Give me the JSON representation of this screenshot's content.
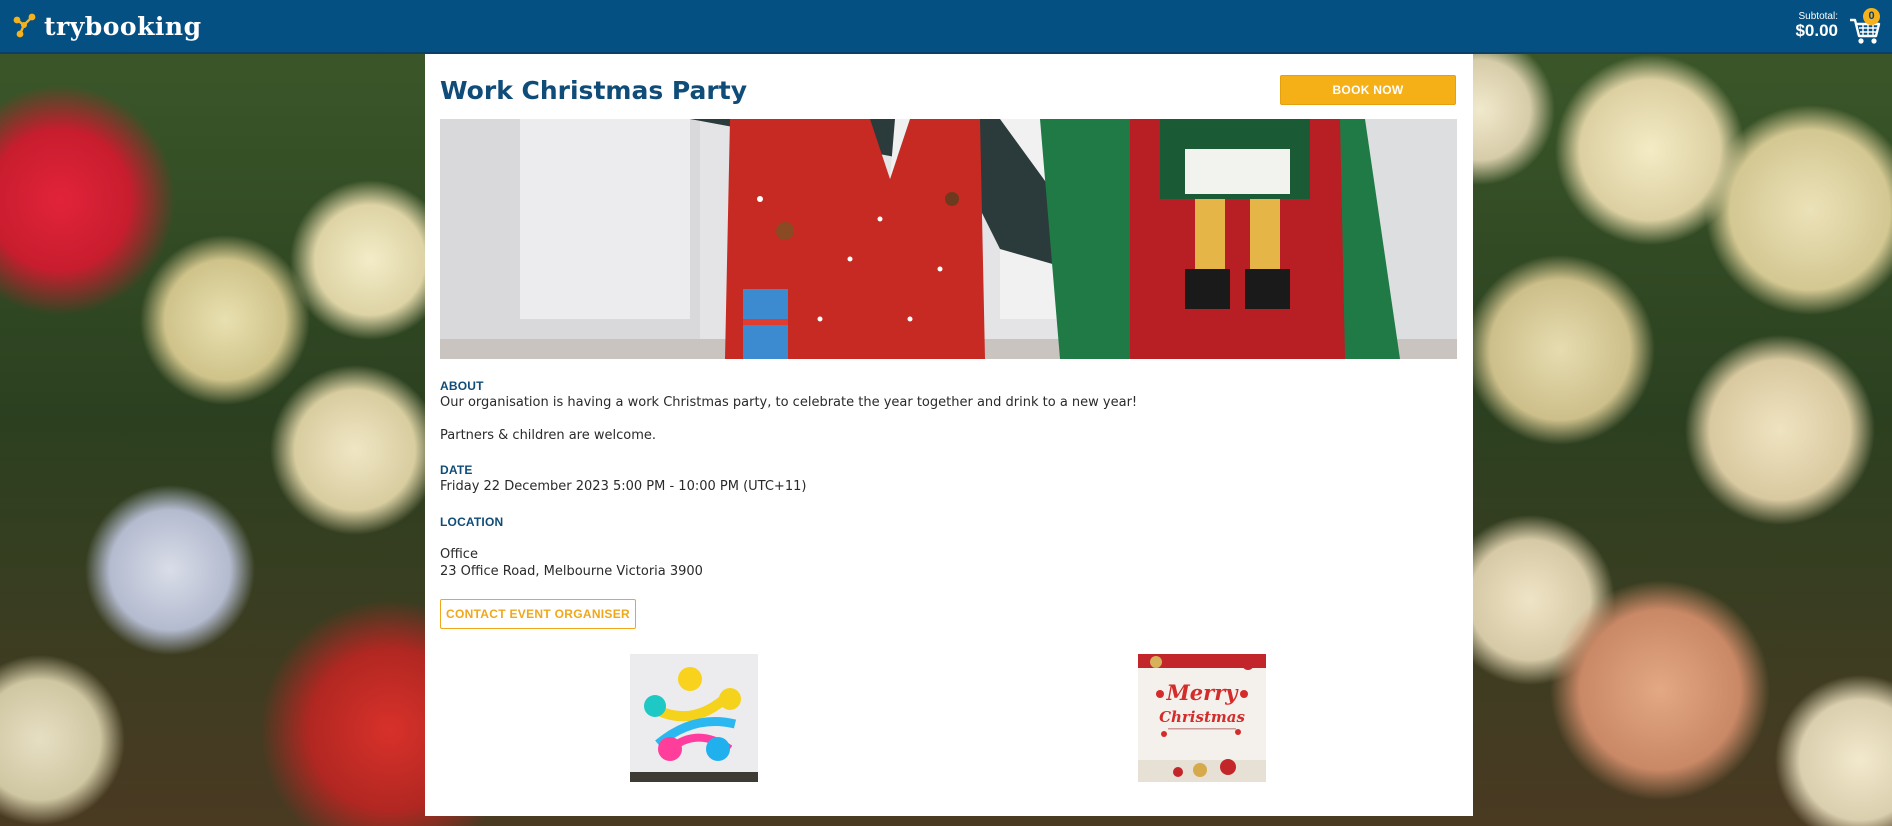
{
  "brand": {
    "name": "trybooking",
    "logo_icon": "trybooking-logo-icon",
    "header_color": "#045082",
    "accent_color": "#f5b018"
  },
  "cart": {
    "subtotal_label": "Subtotal:",
    "subtotal_value": "$0.00",
    "count": "0",
    "icon": "cart-icon"
  },
  "event": {
    "title": "Work Christmas Party",
    "book_now_label": "BOOK NOW",
    "about_label": "ABOUT",
    "about_text_1": "Our organisation is having a work Christmas party, to celebrate the year together and drink to a new year!",
    "about_text_2": "Partners & children are welcome.",
    "date_label": "DATE",
    "date_value": "Friday 22 December 2023 5:00 PM - 10:00 PM (UTC+11)",
    "location_label": "LOCATION",
    "location_name": "Office",
    "location_address": "23 Office Road, Melbourne Victoria 3900",
    "contact_label": "CONTACT EVENT ORGANISER"
  },
  "images": {
    "banner": "christmas-sweaters-banner",
    "thumb_1": "colorful-paint-splash-thumbnail",
    "thumb_2": "merry-christmas-card-thumbnail",
    "thumb_2_text_1": "Merry",
    "thumb_2_text_2": "Christmas"
  }
}
